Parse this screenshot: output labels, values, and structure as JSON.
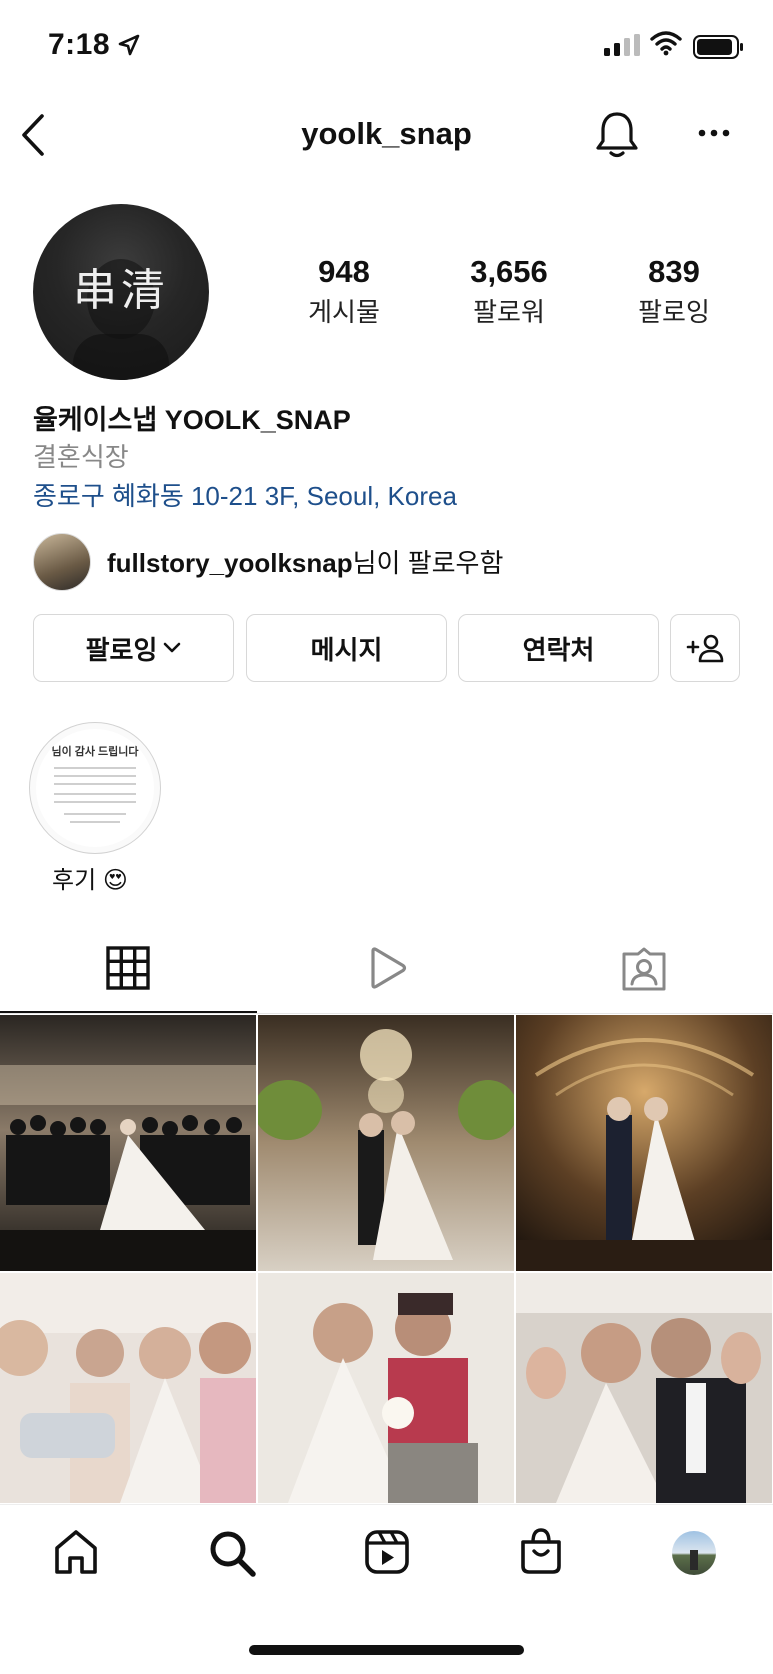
{
  "status_bar": {
    "time": "7:18"
  },
  "header": {
    "username": "yoolk_snap"
  },
  "profile": {
    "avatar_text": "串清",
    "stats": [
      {
        "value": "948",
        "label": "게시물"
      },
      {
        "value": "3,656",
        "label": "팔로워"
      },
      {
        "value": "839",
        "label": "팔로잉"
      }
    ],
    "display_name": "율케이스냅 YOOLK_SNAP",
    "category": "결혼식장",
    "address": "종로구 혜화동 10-21 3F, Seoul, Korea",
    "followed_by_user": "fullstory_yoolksnap",
    "followed_by_suffix": "님이 팔로우함"
  },
  "actions": {
    "following": "팔로잉",
    "message": "메시지",
    "contact": "연락처"
  },
  "highlights": [
    {
      "label": "후기 😍",
      "cover_title": "님이 감사 드립니다"
    }
  ],
  "tabs": [
    "posts-grid",
    "reels",
    "tagged"
  ],
  "posts": [
    {
      "icon": "photo-group-wedding"
    },
    {
      "icon": "photo-couple-chandelier"
    },
    {
      "icon": "photo-couple-aisle"
    },
    {
      "icon": "photo-bridesmaids-selfie"
    },
    {
      "icon": "photo-hanbok-couple"
    },
    {
      "icon": "photo-car-couple"
    }
  ],
  "bottom_nav": [
    "home-icon",
    "search-icon",
    "reels-icon",
    "shop-icon",
    "profile-avatar"
  ],
  "colors": {
    "link": "#1e4f8b",
    "muted": "#888888",
    "border": "#d8d8d8"
  }
}
